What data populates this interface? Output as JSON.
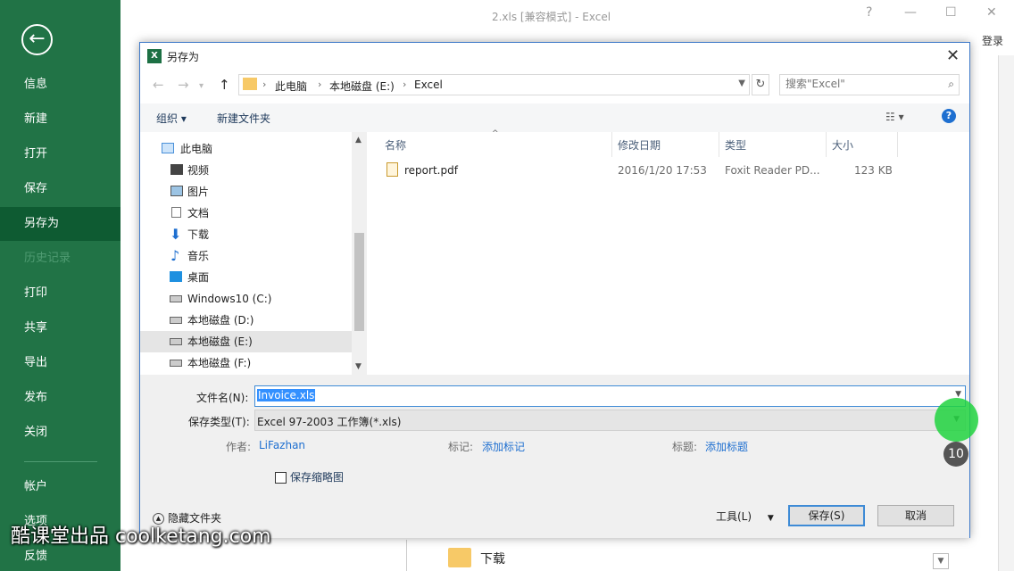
{
  "backstage": {
    "items": [
      {
        "label": "信息"
      },
      {
        "label": "新建"
      },
      {
        "label": "打开"
      },
      {
        "label": "保存"
      },
      {
        "label": "另存为"
      },
      {
        "label": "历史记录"
      },
      {
        "label": "打印"
      },
      {
        "label": "共享"
      },
      {
        "label": "导出"
      },
      {
        "label": "发布"
      },
      {
        "label": "关闭"
      },
      {
        "label": "帐户"
      },
      {
        "label": "选项"
      },
      {
        "label": "反馈"
      }
    ]
  },
  "window": {
    "title": "2.xls  [兼容模式] - Excel",
    "login": "登录",
    "help": "?"
  },
  "background": {
    "folder_label": "下载"
  },
  "dialog": {
    "title": "另存为",
    "breadcrumb": [
      "此电脑",
      "本地磁盘 (E:)",
      "Excel"
    ],
    "search_placeholder": "搜索\"Excel\"",
    "toolbar": {
      "organize": "组织 ▾",
      "new_folder": "新建文件夹",
      "help": "?"
    },
    "tree": [
      {
        "label": "此电脑"
      },
      {
        "label": "视频"
      },
      {
        "label": "图片"
      },
      {
        "label": "文档"
      },
      {
        "label": "下载"
      },
      {
        "label": "音乐"
      },
      {
        "label": "桌面"
      },
      {
        "label": "Windows10 (C:)"
      },
      {
        "label": "本地磁盘 (D:)"
      },
      {
        "label": "本地磁盘 (E:)",
        "selected": true
      },
      {
        "label": "本地磁盘 (F:)"
      }
    ],
    "columns": [
      "名称",
      "修改日期",
      "类型",
      "大小"
    ],
    "files": [
      {
        "name": "report.pdf",
        "modified": "2016/1/20 17:53",
        "type": "Foxit Reader PD...",
        "size": "123 KB"
      }
    ],
    "filename_label": "文件名(N):",
    "filename": "Invoice.xls",
    "filetype_label": "保存类型(T):",
    "filetype": "Excel 97-2003 工作簿(*.xls)",
    "meta": {
      "author_label": "作者:",
      "author": "LiFazhan",
      "tags_label": "标记:",
      "tags": "添加标记",
      "title_label": "标题:",
      "title": "添加标题"
    },
    "save_thumbnail": "保存缩略图",
    "hide_folders": "隐藏文件夹",
    "tools": "工具(L)",
    "save": "保存(S)",
    "cancel": "取消"
  },
  "overlay": {
    "step": "10",
    "watermark": "酷课堂出品 coolketang.com"
  },
  "colors": {
    "excel_green": "#217346",
    "selected_green": "#0e5b32",
    "accent_blue": "#3e8bd6",
    "highlight": "#21d43f"
  }
}
